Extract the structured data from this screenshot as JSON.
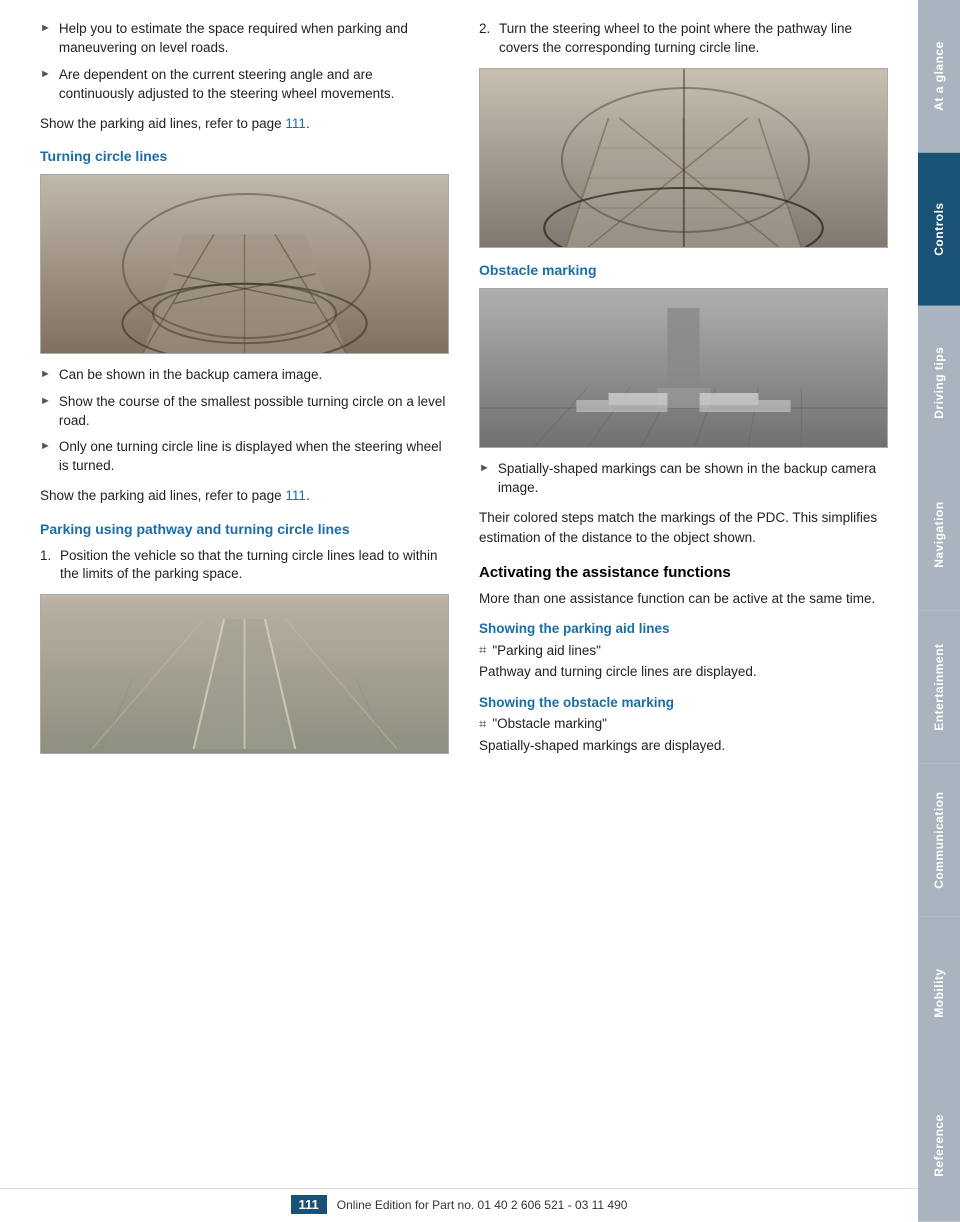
{
  "sidebar": {
    "tabs": [
      {
        "label": "At a glance",
        "active": false
      },
      {
        "label": "Controls",
        "active": true
      },
      {
        "label": "Driving tips",
        "active": false
      },
      {
        "label": "Navigation",
        "active": false
      },
      {
        "label": "Entertainment",
        "active": false
      },
      {
        "label": "Communication",
        "active": false
      },
      {
        "label": "Mobility",
        "active": false
      },
      {
        "label": "Reference",
        "active": false
      }
    ]
  },
  "page": {
    "number": "111",
    "footer_text": "Online Edition for Part no. 01 40 2 606 521 - 03 11 490"
  },
  "intro_bullets": [
    "Help you to estimate the space required when parking and maneuvering on level roads.",
    "Are dependent on the current steering angle and are continuously adjusted to the steering wheel movements."
  ],
  "show_parking_aid_line1": "Show the parking aid lines, refer to page ",
  "show_parking_aid_ref1": "111",
  "show_parking_aid_dot1": ".",
  "section_turning_circle": {
    "heading": "Turning circle lines",
    "bullets": [
      "Can be shown in the backup camera image.",
      "Show the course of the smallest possible turning circle on a level road.",
      "Only one turning circle line is displayed when the steering wheel is turned."
    ],
    "show_line": "Show the parking aid lines, refer to page ",
    "show_ref": "111",
    "show_dot": "."
  },
  "section_parking": {
    "heading": "Parking using pathway and turning circle lines",
    "step1_num": "1.",
    "step1_text": "Position the vehicle so that the turning circle lines lead to within the limits of the parking space.",
    "step2_num": "2.",
    "step2_text": "Turn the steering wheel to the point where the pathway line covers the corresponding turning circle line."
  },
  "section_obstacle": {
    "heading": "Obstacle marking",
    "bullets": [
      "Spatially-shaped markings can be shown in the backup camera image."
    ],
    "body1": "Their colored steps match the markings of the PDC. This simplifies estimation of the distance to the object shown."
  },
  "section_activating": {
    "heading": "Activating the assistance functions",
    "body": "More than one assistance function can be active at the same time."
  },
  "section_show_parking": {
    "heading": "Showing the parking aid lines",
    "menu_item": "\"Parking aid lines\"",
    "body": "Pathway and turning circle lines are displayed."
  },
  "section_show_obstacle": {
    "heading": "Showing the obstacle marking",
    "menu_item": "\"Obstacle marking\"",
    "body": "Spatially-shaped markings are displayed."
  }
}
